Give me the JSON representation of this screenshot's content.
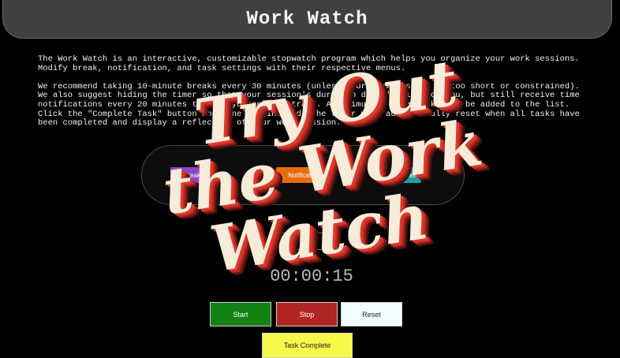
{
  "header": {
    "title": "Work Watch"
  },
  "description": {
    "paragraph1": "The Work Watch is an interactive, customizable stopwatch program which helps you organize your work sessions.\nModify break, notification, and task settings with their respective menus.",
    "paragraph2": "We recommend taking 10-minute breaks every 30 minutes (unless your work session is too short or constrained).\nWe also suggest hiding the timer so that your session's duration doesn't distract you, but still receive time\nnotifications every 20 minutes to keep yourself on track. A maximum of five tasks can be added to the list.\nClick the \"Complete Task\" button when one is finished. The timer will automatically reset when all tasks have\nbeen completed and display a reflection of your work session."
  },
  "menus": {
    "break_label": "Break",
    "notifications_label": "Notifications",
    "tasks_label": "Tasks"
  },
  "timer": {
    "hide_label": "Hide",
    "display": "00:00:15"
  },
  "controls": {
    "start_label": "Start",
    "stop_label": "Stop",
    "reset_label": "Reset",
    "task_complete_label": "Task Complete"
  },
  "promo": {
    "line1": "Try Out",
    "line2": "the Work",
    "line3": "Watch"
  },
  "colors": {
    "background": "#000000",
    "header_bg": "#404040",
    "break_button": "#8e45c4",
    "notifications_button": "#e66d0f",
    "tasks_button": "#19a5a5",
    "start_button": "#128212",
    "stop_button": "#b32525",
    "reset_button": "#f1fcff",
    "task_complete_button": "#f6f94a",
    "promo_text": "#f6ecd9",
    "promo_shadow": "#e0372c"
  }
}
